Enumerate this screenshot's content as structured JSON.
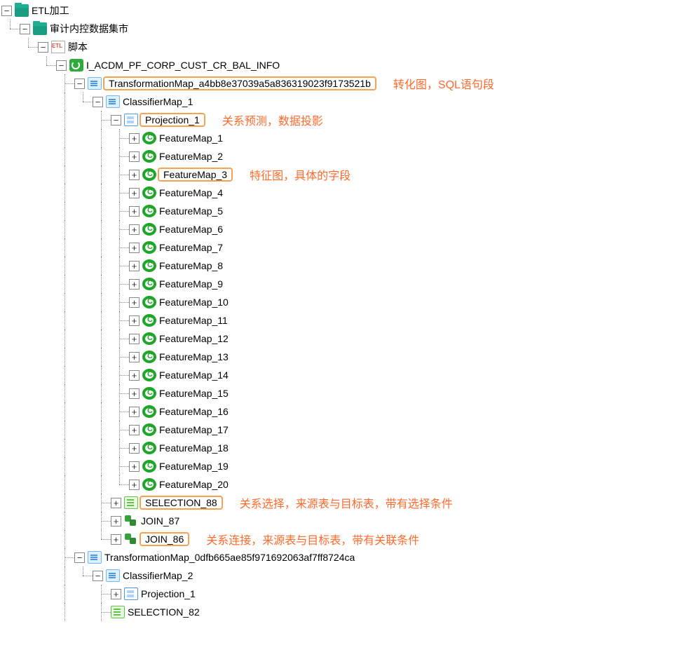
{
  "tree": {
    "root_label": "ETL加工",
    "level1_label": "审计内控数据集市",
    "level2_label": "脚本",
    "job_label": "I_ACDM_PF_CORP_CUST_CR_BAL_INFO",
    "tmap1_label": "TransformationMap_a4bb8e37039a5a836319023f9173521b",
    "cmap1_label": "ClassifierMap_1",
    "proj1_label": "Projection_1",
    "features": [
      "FeatureMap_1",
      "FeatureMap_2",
      "FeatureMap_3",
      "FeatureMap_4",
      "FeatureMap_5",
      "FeatureMap_6",
      "FeatureMap_7",
      "FeatureMap_8",
      "FeatureMap_9",
      "FeatureMap_10",
      "FeatureMap_11",
      "FeatureMap_12",
      "FeatureMap_13",
      "FeatureMap_14",
      "FeatureMap_15",
      "FeatureMap_16",
      "FeatureMap_17",
      "FeatureMap_18",
      "FeatureMap_19",
      "FeatureMap_20"
    ],
    "sel88_label": "SELECTION_88",
    "join87_label": "JOIN_87",
    "join86_label": "JOIN_86",
    "tmap2_label": "TransformationMap_0dfb665ae85f971692063af7ff8724ca",
    "cmap2_label": "ClassifierMap_2",
    "proj2_label": "Projection_1",
    "sel82_label": "SELECTION_82"
  },
  "annotations": {
    "tmap": "转化图，SQL语句段",
    "proj": "关系预测，数据投影",
    "feat": "特征图，具体的字段",
    "sel": "关系选择，来源表与目标表，带有选择条件",
    "join": "关系连接，来源表与目标表，带有关联条件"
  },
  "highlight_feature_index": 2
}
